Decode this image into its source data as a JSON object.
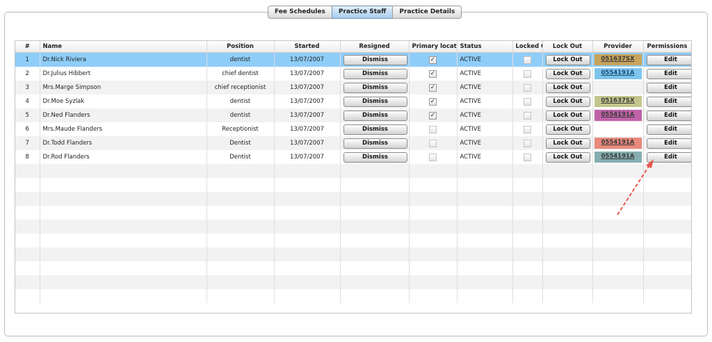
{
  "tabs": [
    {
      "label": "Fee Schedules",
      "active": false
    },
    {
      "label": "Practice Staff",
      "active": true
    },
    {
      "label": "Practice Details",
      "active": false
    }
  ],
  "columns": {
    "num": "#",
    "name": "Name",
    "position": "Position",
    "started": "Started",
    "resigned": "Resigned",
    "primary": "Primary locatic",
    "status": "Status",
    "locked": "Locked O",
    "lockout": "Lock Out",
    "provider": "Provider",
    "permissions": "Permissions"
  },
  "labels": {
    "dismiss": "Dismiss",
    "lockout": "Lock Out",
    "edit": "Edit"
  },
  "staff": [
    {
      "num": "1",
      "name": "Dr.Nick Riviera",
      "position": "dentist",
      "started": "13/07/2007",
      "primary": true,
      "status": "ACTIVE",
      "locked": false,
      "provider": "051637SX",
      "provider_color": "#c9a45c",
      "selected": true
    },
    {
      "num": "2",
      "name": "Dr.Julius Hibbert",
      "position": "chief dentist",
      "started": "13/07/2007",
      "primary": true,
      "status": "ACTIVE",
      "locked": false,
      "provider": "0554191A",
      "provider_color": "#7ec4ec",
      "selected": false
    },
    {
      "num": "3",
      "name": "Mrs.Marge Simpson",
      "position": "chief receptionist",
      "started": "13/07/2007",
      "primary": true,
      "status": "ACTIVE",
      "locked": false,
      "provider": "",
      "provider_color": "",
      "selected": false
    },
    {
      "num": "4",
      "name": "Dr.Moe Syzlak",
      "position": "dentist",
      "started": "13/07/2007",
      "primary": true,
      "status": "ACTIVE",
      "locked": false,
      "provider": "051637SX",
      "provider_color": "#c3c68c",
      "selected": false
    },
    {
      "num": "5",
      "name": "Dr.Ned Flanders",
      "position": "dentist",
      "started": "13/07/2007",
      "primary": true,
      "status": "ACTIVE",
      "locked": false,
      "provider": "0554191A",
      "provider_color": "#c062a8",
      "selected": false
    },
    {
      "num": "6",
      "name": "Mrs.Maude Flanders",
      "position": "Receptionist",
      "started": "13/07/2007",
      "primary": false,
      "status": "ACTIVE",
      "locked": false,
      "provider": "",
      "provider_color": "",
      "selected": false
    },
    {
      "num": "7",
      "name": "Dr.Todd Flanders",
      "position": "Dentist",
      "started": "13/07/2007",
      "primary": false,
      "status": "ACTIVE",
      "locked": false,
      "provider": "0554191A",
      "provider_color": "#e8897a",
      "selected": false
    },
    {
      "num": "8",
      "name": "Dr.Rod Flanders",
      "position": "Dentist",
      "started": "13/07/2007",
      "primary": false,
      "status": "ACTIVE",
      "locked": false,
      "provider": "0554191A",
      "provider_color": "#86aeb0",
      "selected": false
    }
  ],
  "empty_rows": 10,
  "colors": {
    "selected_row": "#8fcdf9",
    "arrow": "#e8574a"
  }
}
